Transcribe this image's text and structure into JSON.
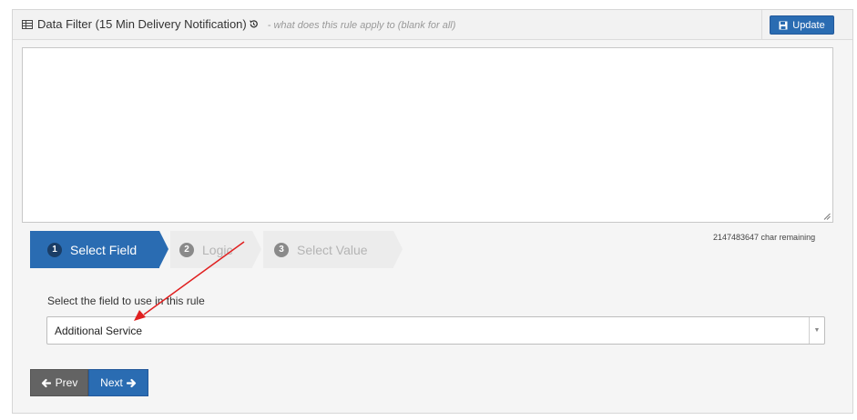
{
  "header": {
    "title": "Data Filter (15 Min Delivery Notification)",
    "hint": "- what does this rule apply to (blank for all)",
    "update_label": "Update"
  },
  "textarea": {
    "value": "",
    "char_remaining": "2147483647 char remaining"
  },
  "wizard": {
    "steps": [
      {
        "num": "1",
        "label": "Select Field",
        "state": "active"
      },
      {
        "num": "2",
        "label": "Logic",
        "state": "inactive"
      },
      {
        "num": "3",
        "label": "Select Value",
        "state": "inactive"
      }
    ]
  },
  "field": {
    "label": "Select the field to use in this rule",
    "selected": "Additional Service"
  },
  "nav": {
    "prev_label": "Prev",
    "next_label": "Next"
  },
  "colors": {
    "accent": "#2a6cb2",
    "annotation_arrow": "#e02020"
  },
  "icons": [
    "table-icon",
    "history-icon",
    "save-icon",
    "resize-grip-icon",
    "caret-down-icon",
    "arrow-left-icon",
    "arrow-right-icon"
  ]
}
